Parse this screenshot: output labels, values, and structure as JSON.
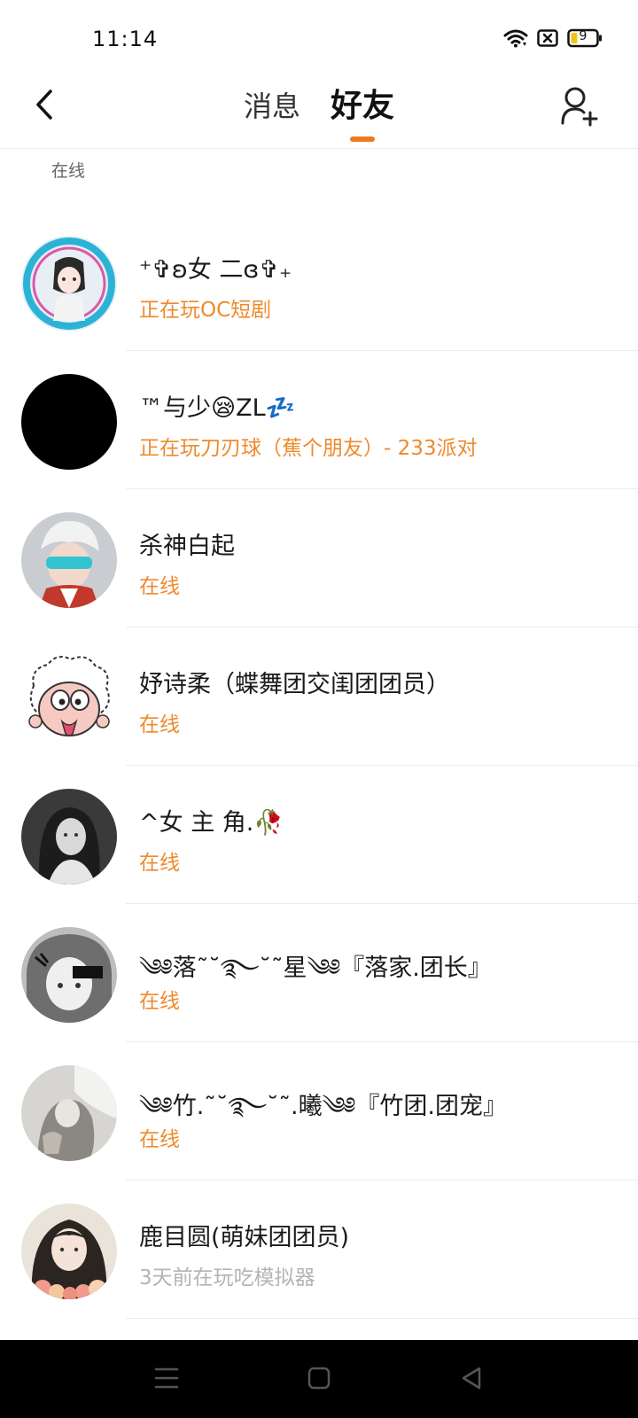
{
  "status_bar": {
    "time": "11:14",
    "battery_level": "9",
    "icons": [
      "wifi-icon",
      "sim-blocked-icon",
      "battery-icon"
    ]
  },
  "header": {
    "tabs": [
      {
        "label": "消息",
        "active": false
      },
      {
        "label": "好友",
        "active": true
      }
    ],
    "back_icon": "chevron-left-icon",
    "add_friend_icon": "add-user-icon"
  },
  "colors": {
    "accent": "#ee7a1f",
    "status_online": "#ee8a2d",
    "status_offline": "#b4b4b4",
    "divider": "#ececec",
    "nav_bar": "#000000"
  },
  "section": {
    "label": "在线"
  },
  "friends": [
    {
      "name": "⁺✞ʚ女  二ɞ✞₊",
      "status": "正在玩OC短剧",
      "online": true
    },
    {
      "name": "™与少😪ZL💤",
      "status": "正在玩刀刃球（蕉个朋友）- 233派对",
      "online": true
    },
    {
      "name": "杀神白起",
      "status": "在线",
      "online": true
    },
    {
      "name": "妤诗柔（蝶舞团交闺团团员）",
      "status": "在线",
      "online": true
    },
    {
      "name": "^女  主   角.🥀",
      "status": "在线",
      "online": true
    },
    {
      "name": "༄༅落˜˘࿐˘˜星༄༅『落家.团长』",
      "status": "在线",
      "online": true
    },
    {
      "name": "༄༅竹.˜˘࿐˘˜.曦༄༅『竹团.团宠』",
      "status": "在线",
      "online": true
    },
    {
      "name": "鹿目圆(萌妹团团员)",
      "status": "3天前在玩吃模拟器",
      "online": false
    }
  ],
  "nav_bar": {
    "buttons": [
      "menu-icon",
      "home-icon",
      "back-triangle-icon"
    ]
  }
}
